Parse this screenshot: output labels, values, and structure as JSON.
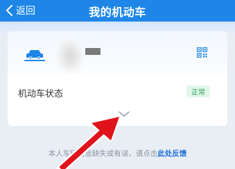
{
  "header": {
    "back_label": "返回",
    "title": "我的机动车"
  },
  "vehicle": {
    "status_label": "机动车状态",
    "status_value": "正常"
  },
  "footer": {
    "feedback_prefix": "本人车辆信息缺失或有误，请点击",
    "feedback_link": "此处反馈"
  },
  "colors": {
    "primary": "#1f86e8",
    "status_green": "#27a35a",
    "annotation_arrow": "#e0121b"
  },
  "icons": [
    "chevron-left-icon",
    "car-icon",
    "qr-code-icon",
    "chevron-down-icon",
    "arrow-annotation"
  ]
}
